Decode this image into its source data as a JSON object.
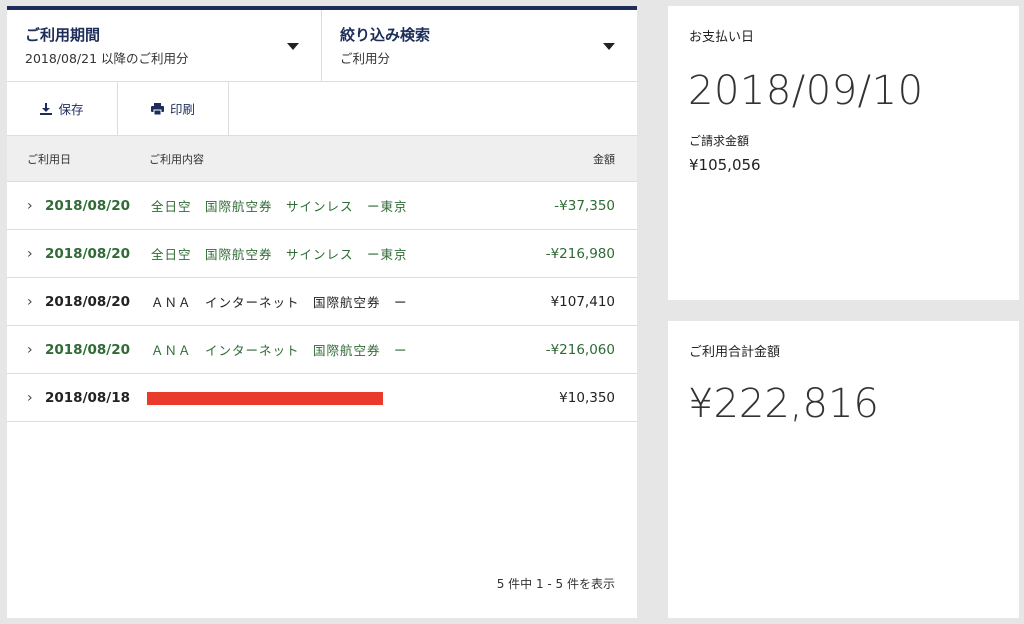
{
  "filters": {
    "period": {
      "title": "ご利用期間",
      "value": "2018/08/21 以降のご利用分"
    },
    "search": {
      "title": "絞り込み検索",
      "value": "ご利用分"
    }
  },
  "actions": {
    "save": "保存",
    "print": "印刷"
  },
  "table": {
    "headers": {
      "date": "ご利用日",
      "desc": "ご利用内容",
      "amount": "金額"
    },
    "rows": [
      {
        "date": "2018/08/20",
        "desc": "全日空　国際航空券　サインレス　ー東京",
        "amount": "-¥37,350",
        "color": "#2e6b35"
      },
      {
        "date": "2018/08/20",
        "desc": "全日空　国際航空券　サインレス　ー東京",
        "amount": "-¥216,980",
        "color": "#2e6b35"
      },
      {
        "date": "2018/08/20",
        "desc": "ＡＮＡ　インターネット　国際航空券　ー",
        "amount": "¥107,410",
        "color": "#222222"
      },
      {
        "date": "2018/08/20",
        "desc": "ＡＮＡ　インターネット　国際航空券　ー",
        "amount": "-¥216,060",
        "color": "#2e6b35"
      },
      {
        "date": "2018/08/18",
        "desc": "",
        "amount": "¥10,350",
        "color": "#222222",
        "redacted": true
      }
    ]
  },
  "pager": "5 件中 1 - 5 件を表示",
  "payment": {
    "label": "お支払い日",
    "date": "2018/09/10",
    "claim_label": "ご請求金額",
    "claim_amount": "¥105,056"
  },
  "total": {
    "label": "ご利用合計金額",
    "amount": "¥222,816"
  },
  "colors": {
    "navy": "#1c2d5a",
    "green": "#2e6b35",
    "redact": "#ea3a2b"
  }
}
